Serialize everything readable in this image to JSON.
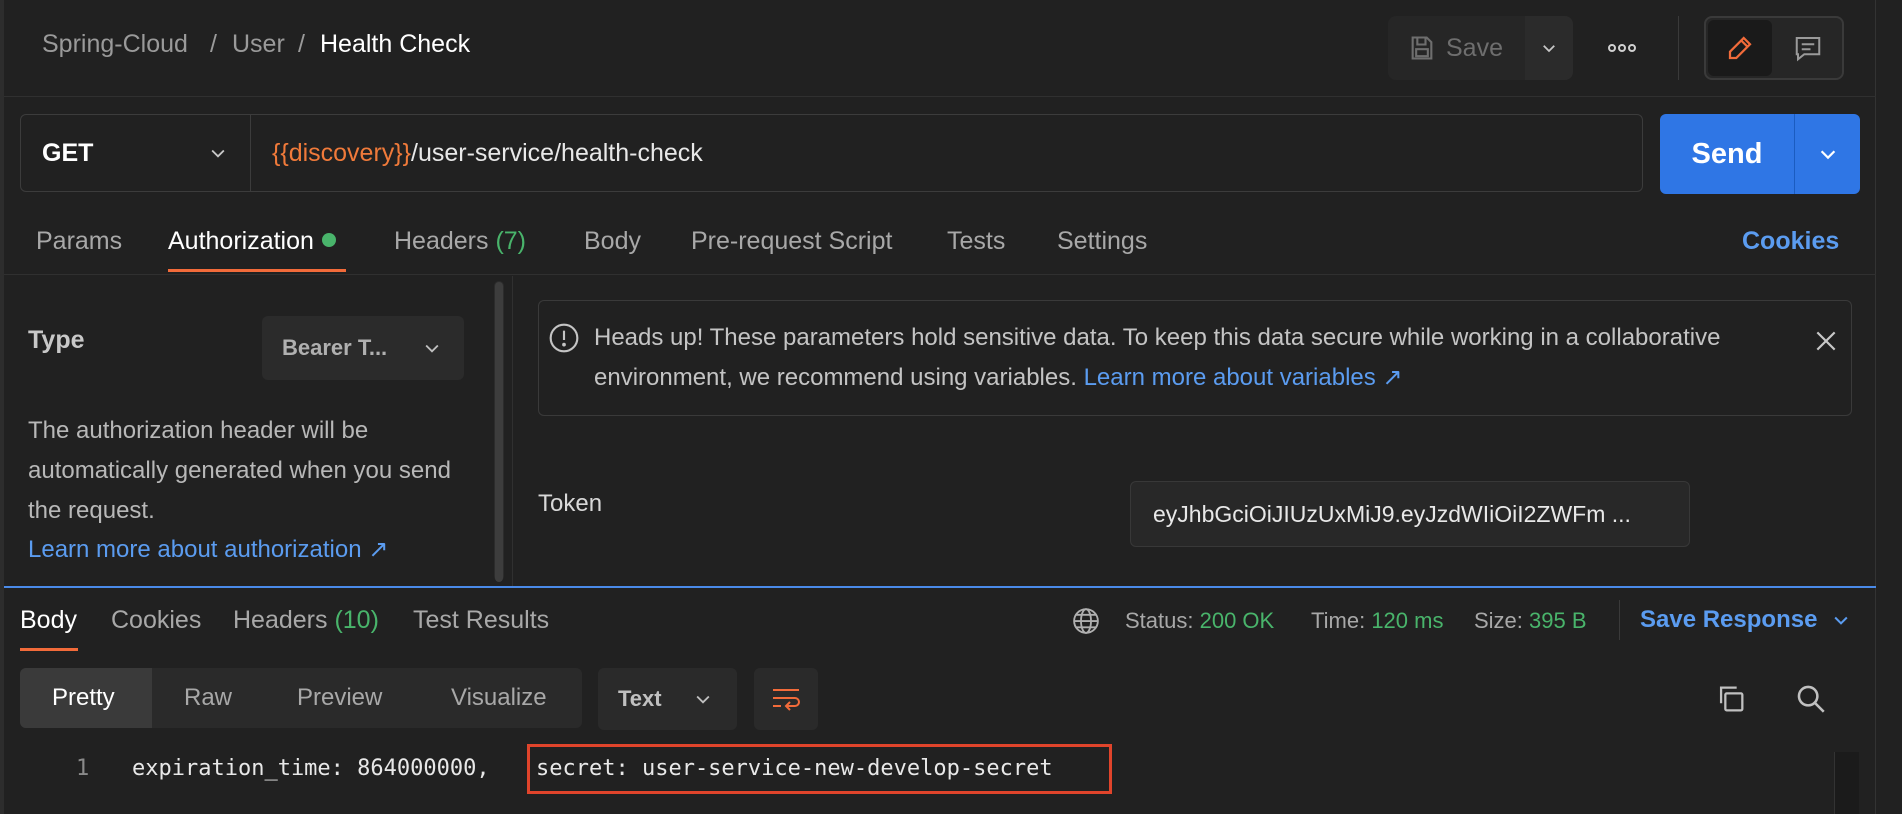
{
  "breadcrumb": {
    "collection": "Spring-Cloud",
    "sep1": "/",
    "folder": "User",
    "sep2": "/",
    "request": "Health Check"
  },
  "toolbar": {
    "save_label": "Save"
  },
  "request": {
    "method": "GET",
    "url_variable": "{{discovery}}",
    "url_path": "/user-service/health-check",
    "send_label": "Send"
  },
  "request_tabs": {
    "params": "Params",
    "authorization": "Authorization",
    "headers": "Headers",
    "headers_count": "(7)",
    "body": "Body",
    "pre_request": "Pre-request Script",
    "tests": "Tests",
    "settings": "Settings",
    "cookies": "Cookies"
  },
  "auth": {
    "type_label": "Type",
    "type_value": "Bearer T...",
    "description": "The authorization header will be automatically generated when you send the request.",
    "learn_more": "Learn more about authorization ↗"
  },
  "banner": {
    "text": "Heads up! These parameters hold sensitive data. To keep this data secure while working in a collaborative environment, we recommend using variables.",
    "link": "Learn more about variables ↗"
  },
  "token": {
    "label": "Token",
    "value": "eyJhbGciOiJIUzUxMiJ9.eyJzdWIiOiI2ZWFm ..."
  },
  "response_tabs": {
    "body": "Body",
    "cookies": "Cookies",
    "headers": "Headers",
    "headers_count": "(10)",
    "test_results": "Test Results"
  },
  "response_status": {
    "status_label": "Status:",
    "status_value": "200 OK",
    "time_label": "Time:",
    "time_value": "120 ms",
    "size_label": "Size:",
    "size_value": "395 B",
    "save_response": "Save Response"
  },
  "format_tabs": {
    "pretty": "Pretty",
    "raw": "Raw",
    "preview": "Preview",
    "visualize": "Visualize",
    "text_select": "Text"
  },
  "code": {
    "line_number": "1",
    "prefix": "expiration_time: 864000000,",
    "highlighted": "secret: user-service-new-develop-secret"
  },
  "colors": {
    "accent_orange": "#f26b3a",
    "send_blue": "#2f76e5",
    "link_blue": "#5b9cf0",
    "status_green": "#49b46b",
    "highlight_red": "#e0442b"
  }
}
